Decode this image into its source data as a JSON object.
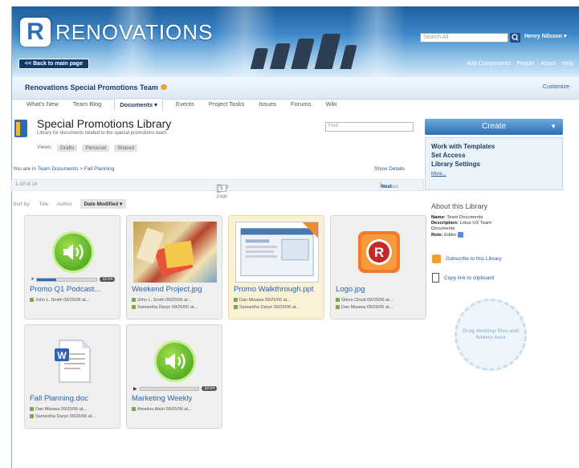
{
  "header": {
    "brand_letter": "R",
    "brand_name": "RENOVATIONS",
    "search_placeholder": "Search All",
    "user_name": "Henry Nilsson ▾",
    "back_label": "<< Back to main page",
    "top_links": [
      "Add Components",
      "People",
      "About",
      "Help"
    ]
  },
  "team": {
    "name": "Renovations Special Promotions Team",
    "customize_label": "Customize",
    "tabs": [
      "What's New",
      "Team Blog",
      "Documents ▾",
      "Events",
      "Project Tasks",
      "Issues",
      "Forums",
      "Wiki"
    ],
    "active_tab": "Documents ▾"
  },
  "library": {
    "title": "Special Promotions Library",
    "description": "Library for documents related to the special promotions team.",
    "find_placeholder": "Find",
    "views_label": "Views:",
    "views": [
      "Drafts",
      "Personal",
      "Shared"
    ],
    "crumb_prefix": "You are in",
    "crumb_path": "Team Documents > Fall Planning",
    "show_details": "Show Details",
    "range": "1-10 of 14",
    "jump_label": "Jump to page",
    "page_current": "1",
    "page_of": "of 2",
    "previous": "Previous",
    "next": "Next",
    "sort_label": "Sort by:",
    "sort_title": "Title",
    "sort_author": "Author",
    "sort_selected": "Date Modified ▾"
  },
  "files": [
    {
      "title": "Promo Q1 Podcast...",
      "type": "audio",
      "time": "32:04",
      "progress": 0.32,
      "meta": [
        "John L. Smith  09/25/06 at..."
      ]
    },
    {
      "title": "Weekend Project.jpg",
      "type": "photo",
      "meta": [
        "John L. Smith  09/25/06 at...",
        "Samantha Daryn  09/25/06 at..."
      ]
    },
    {
      "title": "Promo Walkthrough.ppt",
      "type": "ppt",
      "highlighted": true,
      "meta": [
        "Dan Misawa  09/25/06 at...",
        "Samantha Daryn  09/25/06 at..."
      ]
    },
    {
      "title": "Logo.jpg",
      "type": "logo",
      "meta": [
        "Glenn Cloud  09/25/06 at...",
        "Dan Misawa  09/25/06 at..."
      ]
    },
    {
      "title": "Fall Planning.doc",
      "type": "doc",
      "meta": [
        "Dan Misawa  09/25/06 at...",
        "Samantha Daryn  09/25/06 at..."
      ]
    },
    {
      "title": "Marketing Weekly",
      "type": "audio",
      "time": "32:04",
      "progress": 0.0,
      "meta": [
        "Amadou Alain  09/25/06 at..."
      ]
    }
  ],
  "sidebar": {
    "create_label": "Create",
    "actions": [
      "Work with Templates",
      "Set Access",
      "Library Settings"
    ],
    "more_label": "More...",
    "about_title": "About this Library",
    "name_label": "Name:",
    "name_value": "Team Documents",
    "desc_label": "Description:",
    "desc_value": "Lotus UX Team Documents",
    "role_label": "Role:",
    "role_value": "Editor",
    "subscribe_label": "Subscribe to this Library",
    "copy_label": "Copy link to clipboard",
    "drop_text": "Drag desktop files and folders here"
  },
  "colors": {
    "accent": "#2a5a99",
    "create": "#2d6fb5",
    "highlight": "#fbf1d7"
  }
}
